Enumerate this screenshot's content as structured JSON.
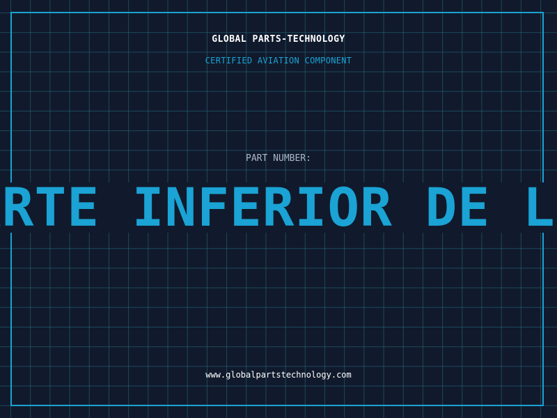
{
  "header": {
    "brand": "GLOBAL PARTS-TECHNOLOGY",
    "subtitle": "CERTIFIED AVIATION COMPONENT"
  },
  "part": {
    "label": "PART NUMBER:",
    "value": "ARTE INFERIOR DE L"
  },
  "footer": {
    "website": "www.globalpartstechnology.com"
  },
  "colors": {
    "background": "#101a2c",
    "accent": "#1aa3d4",
    "grid": "#286e82",
    "text": "#ffffff",
    "muted": "#aab7c8"
  }
}
